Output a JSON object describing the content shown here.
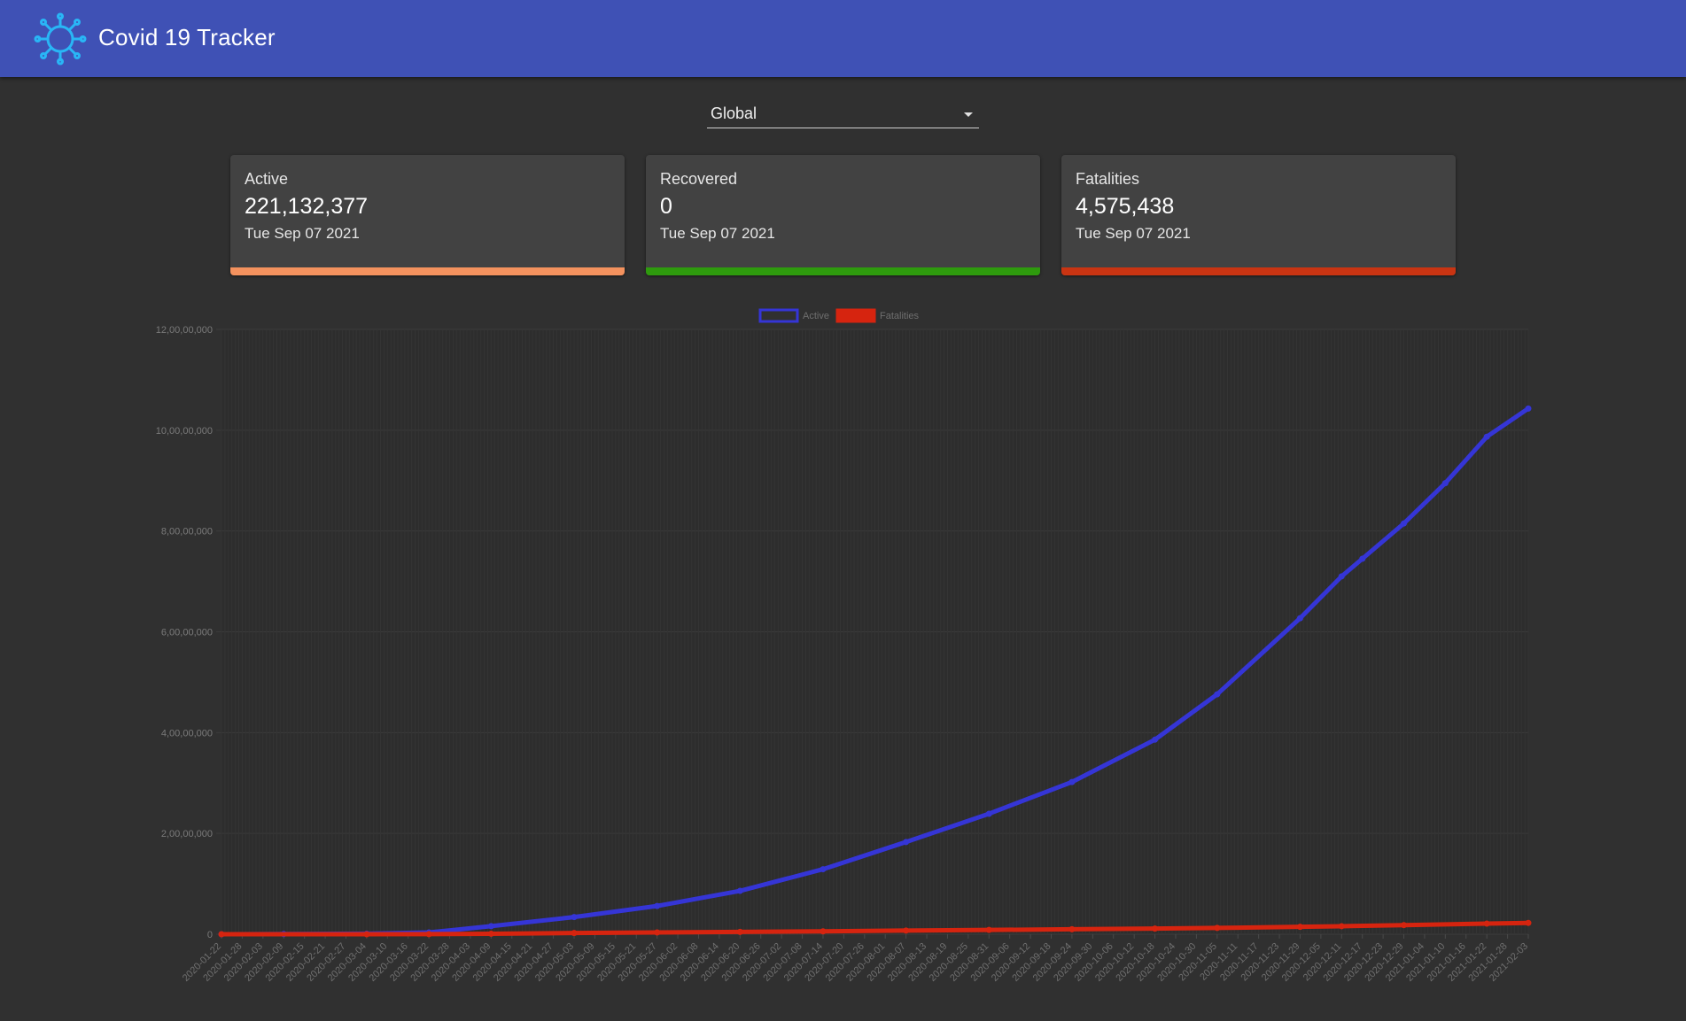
{
  "header": {
    "title": "Covid 19 Tracker",
    "logo_icon": "virus-icon",
    "background": "#3f51b5"
  },
  "region_select": {
    "value": "Global"
  },
  "cards": [
    {
      "title": "Active",
      "value": "221,132,377",
      "date": "Tue Sep 07 2021",
      "accent": "#f4925e"
    },
    {
      "title": "Recovered",
      "value": "0",
      "date": "Tue Sep 07 2021",
      "accent": "#2e9a0d"
    },
    {
      "title": "Fatalities",
      "value": "4,575,438",
      "date": "Tue Sep 07 2021",
      "accent": "#c93412"
    }
  ],
  "chart_data": {
    "type": "line",
    "legend": [
      "Active",
      "Fatalities"
    ],
    "legend_position": "top-center",
    "grid": true,
    "ylim": [
      0,
      120000000
    ],
    "y_tick_labels": [
      "0",
      "2,00,00,000",
      "4,00,00,000",
      "6,00,00,000",
      "8,00,00,000",
      "10,00,00,000",
      "12,00,00,000"
    ],
    "x_tick_labels": [
      "2020-01-22",
      "2020-01-28",
      "2020-02-03",
      "2020-02-09",
      "2020-02-15",
      "2020-02-21",
      "2020-02-27",
      "2020-03-04",
      "2020-03-10",
      "2020-03-16",
      "2020-03-22",
      "2020-03-28",
      "2020-04-03",
      "2020-04-09",
      "2020-04-15",
      "2020-04-21",
      "2020-04-27",
      "2020-05-03",
      "2020-05-09",
      "2020-05-15",
      "2020-05-21",
      "2020-05-27",
      "2020-06-02",
      "2020-06-08",
      "2020-06-14",
      "2020-06-20",
      "2020-06-26",
      "2020-07-02",
      "2020-07-08",
      "2020-07-14",
      "2020-07-20",
      "2020-07-26",
      "2020-08-01",
      "2020-08-07",
      "2020-08-13",
      "2020-08-19",
      "2020-08-25",
      "2020-08-31",
      "2020-09-06",
      "2020-09-12",
      "2020-09-18",
      "2020-09-24",
      "2020-09-30",
      "2020-10-06",
      "2020-10-12",
      "2020-10-18",
      "2020-10-24",
      "2020-10-30",
      "2020-11-05",
      "2020-11-11",
      "2020-11-17",
      "2020-11-23",
      "2020-11-29",
      "2020-12-05",
      "2020-12-11",
      "2020-12-17",
      "2020-12-23",
      "2020-12-29",
      "2021-01-04",
      "2021-01-10",
      "2021-01-16",
      "2021-01-22",
      "2021-01-28",
      "2021-02-03"
    ],
    "series": [
      {
        "name": "Active",
        "color": "#3535d6",
        "x": [
          "2020-01-22",
          "2020-02-09",
          "2020-03-04",
          "2020-03-22",
          "2020-04-09",
          "2020-05-03",
          "2020-05-27",
          "2020-06-20",
          "2020-07-14",
          "2020-08-07",
          "2020-08-31",
          "2020-09-24",
          "2020-10-18",
          "2020-11-05",
          "2020-11-29",
          "2020-12-11",
          "2020-12-17",
          "2020-12-29",
          "2021-01-10",
          "2021-01-22",
          "2021-02-03"
        ],
        "values": [
          600,
          40000,
          100000,
          350000,
          1600000,
          3400000,
          5600000,
          8600000,
          12900000,
          18300000,
          23900000,
          30200000,
          38600000,
          47600000,
          62700000,
          71000000,
          74500000,
          81500000,
          89500000,
          98700000,
          104300000
        ]
      },
      {
        "name": "Fatalities",
        "color": "#d6240f",
        "x": [
          "2020-01-22",
          "2020-03-04",
          "2020-03-22",
          "2020-04-09",
          "2020-05-03",
          "2020-05-27",
          "2020-06-20",
          "2020-07-14",
          "2020-08-07",
          "2020-08-31",
          "2020-09-24",
          "2020-10-18",
          "2020-11-05",
          "2020-11-29",
          "2020-12-11",
          "2020-12-29",
          "2021-01-22",
          "2021-02-03"
        ],
        "values": [
          17,
          3200,
          15000,
          95000,
          245000,
          355000,
          465000,
          575000,
          725000,
          850000,
          985000,
          1115000,
          1250000,
          1465000,
          1590000,
          1810000,
          2100000,
          2250000
        ]
      }
    ]
  }
}
